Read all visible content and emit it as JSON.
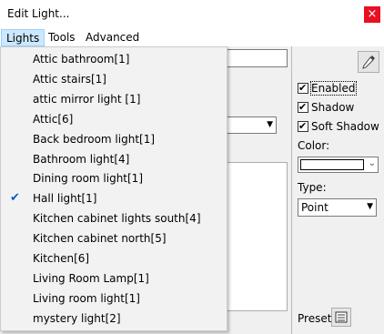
{
  "window": {
    "title": "Edit Light...",
    "close_symbol": "×"
  },
  "menubar": {
    "items": [
      "Lights",
      "Tools",
      "Advanced"
    ]
  },
  "lights_menu": {
    "items": [
      {
        "label": "Attic bathroom[1]",
        "checked": false
      },
      {
        "label": "Attic stairs[1]",
        "checked": false
      },
      {
        "label": "attic mirror light  [1]",
        "checked": false
      },
      {
        "label": "Attic[6]",
        "checked": false
      },
      {
        "label": "Back bedroom light[1]",
        "checked": false
      },
      {
        "label": "Bathroom light[4]",
        "checked": false
      },
      {
        "label": "Dining room light[1]",
        "checked": false
      },
      {
        "label": "Hall light[1]",
        "checked": true
      },
      {
        "label": "Kitchen cabinet lights south[4]",
        "checked": false
      },
      {
        "label": "Kitchen cabinet north[5]",
        "checked": false
      },
      {
        "label": "Kitchen[6]",
        "checked": false
      },
      {
        "label": "Living Room Lamp[1]",
        "checked": false
      },
      {
        "label": "Living room light[1]",
        "checked": false
      },
      {
        "label": "mystery light[2]",
        "checked": false
      }
    ],
    "check_symbol": "✔"
  },
  "properties": {
    "enabled_label": "Enabled",
    "shadow_label": "Shadow",
    "soft_shadow_label": "Soft Shadow",
    "color_label": "Color:",
    "color_value": "#ffffff",
    "type_label": "Type:",
    "type_value": "Point",
    "preset_label": "Preset:",
    "enabled": true,
    "shadow": true,
    "soft_shadow": true
  },
  "icons": {
    "picker": "eyedropper-icon",
    "preset": "preset-list-icon",
    "dropdown_arrow": "chevron-down-icon"
  }
}
